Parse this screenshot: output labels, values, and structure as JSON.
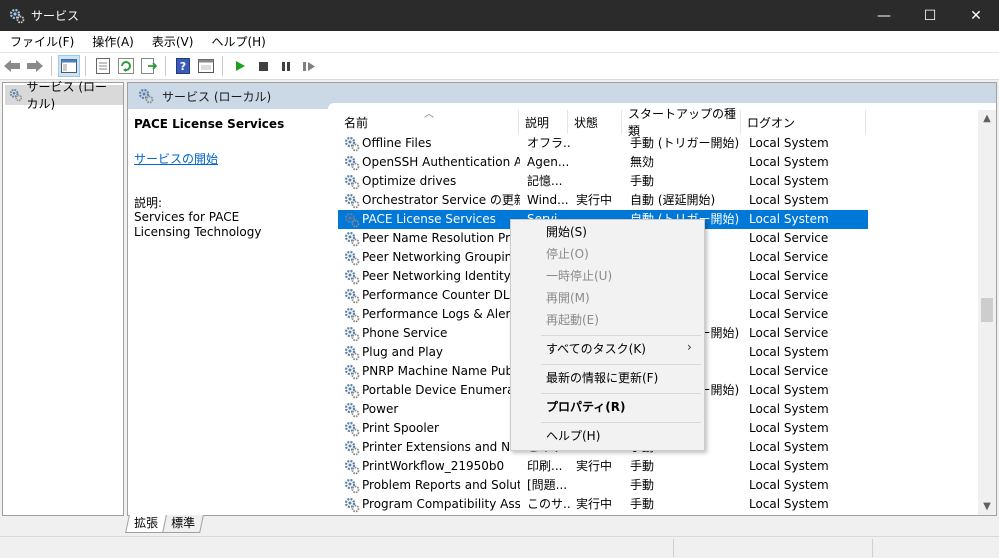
{
  "window": {
    "title": "サービス",
    "minimize": "—",
    "maximize": "☐",
    "close": "✕"
  },
  "menu": [
    "ファイル(F)",
    "操作(A)",
    "表示(V)",
    "ヘルプ(H)"
  ],
  "tree": {
    "root": "サービス (ローカル)"
  },
  "panel_header": "サービス (ローカル)",
  "details": {
    "service_name": "PACE License Services",
    "start_link": "サービスの開始",
    "description_label": "説明:",
    "description": "Services for PACE Licensing Technology"
  },
  "columns": [
    "名前",
    "説明",
    "状態",
    "スタートアップの種類",
    "ログオン"
  ],
  "services": [
    {
      "name": "Offline Files",
      "desc": "オフラ...",
      "status": "",
      "startup": "手動 (トリガー開始)",
      "logon": "Local System"
    },
    {
      "name": "OpenSSH Authentication A...",
      "desc": "Agen...",
      "status": "",
      "startup": "無効",
      "logon": "Local System"
    },
    {
      "name": "Optimize drives",
      "desc": "記憶...",
      "status": "",
      "startup": "手動",
      "logon": "Local System"
    },
    {
      "name": "Orchestrator Service の更新",
      "desc": "Wind...",
      "status": "実行中",
      "startup": "自動 (遅延開始)",
      "logon": "Local System"
    },
    {
      "name": "PACE License Services",
      "desc": "Servi...",
      "status": "",
      "startup": "自動 (トリガー開始)",
      "logon": "Local System",
      "selected": true
    },
    {
      "name": "Peer Name Resolution Prot...",
      "desc": "",
      "status": "",
      "startup": "",
      "logon": "Local Service"
    },
    {
      "name": "Peer Networking Grouping",
      "desc": "",
      "status": "",
      "startup": "",
      "logon": "Local Service"
    },
    {
      "name": "Peer Networking Identity M...",
      "desc": "",
      "status": "",
      "startup": "",
      "logon": "Local Service"
    },
    {
      "name": "Performance Counter DLL H...",
      "desc": "",
      "status": "",
      "startup": "",
      "logon": "Local Service"
    },
    {
      "name": "Performance Logs & Alerts",
      "desc": "",
      "status": "",
      "startup": "",
      "logon": "Local Service"
    },
    {
      "name": "Phone Service",
      "desc": "",
      "status": "",
      "startup": "手動 (トリガー開始)",
      "logon": "Local Service"
    },
    {
      "name": "Plug and Play",
      "desc": "",
      "status": "",
      "startup": "",
      "logon": "Local System"
    },
    {
      "name": "PNRP Machine Name Publi...",
      "desc": "",
      "status": "",
      "startup": "",
      "logon": "Local Service"
    },
    {
      "name": "Portable Device Enumerator...",
      "desc": "",
      "status": "",
      "startup": "手動 (トリガー開始)",
      "logon": "Local System"
    },
    {
      "name": "Power",
      "desc": "",
      "status": "",
      "startup": "",
      "logon": "Local System"
    },
    {
      "name": "Print Spooler",
      "desc": "",
      "status": "",
      "startup": "",
      "logon": "Local System"
    },
    {
      "name": "Printer Extensions and Notif...",
      "desc": "このサ...",
      "status": "",
      "startup": "手動",
      "logon": "Local System"
    },
    {
      "name": "PrintWorkflow_21950b0",
      "desc": "印刷...",
      "status": "実行中",
      "startup": "手動",
      "logon": "Local System"
    },
    {
      "name": "Problem Reports and Soluti...",
      "desc": "[問題...",
      "status": "",
      "startup": "手動",
      "logon": "Local System"
    },
    {
      "name": "Program Compatibility Assis...",
      "desc": "このサ...",
      "status": "実行中",
      "startup": "手動",
      "logon": "Local System"
    }
  ],
  "context_menu": [
    {
      "label": "開始(S)",
      "disabled": false
    },
    {
      "label": "停止(O)",
      "disabled": true
    },
    {
      "label": "一時停止(U)",
      "disabled": true
    },
    {
      "label": "再開(M)",
      "disabled": true
    },
    {
      "label": "再起動(E)",
      "disabled": true
    },
    {
      "label": "すべてのタスク(K)",
      "disabled": false,
      "submenu": true
    },
    {
      "label": "最新の情報に更新(F)",
      "disabled": false
    },
    {
      "label": "プロパティ(R)",
      "disabled": false,
      "bold": true
    },
    {
      "label": "ヘルプ(H)",
      "disabled": false
    }
  ],
  "tabs": [
    "拡張",
    "標準"
  ],
  "colors": {
    "selection": "#0078d7",
    "title_bar": "#2b2b2b",
    "panel_header": "#cbd8e6",
    "link": "#0066cc"
  }
}
